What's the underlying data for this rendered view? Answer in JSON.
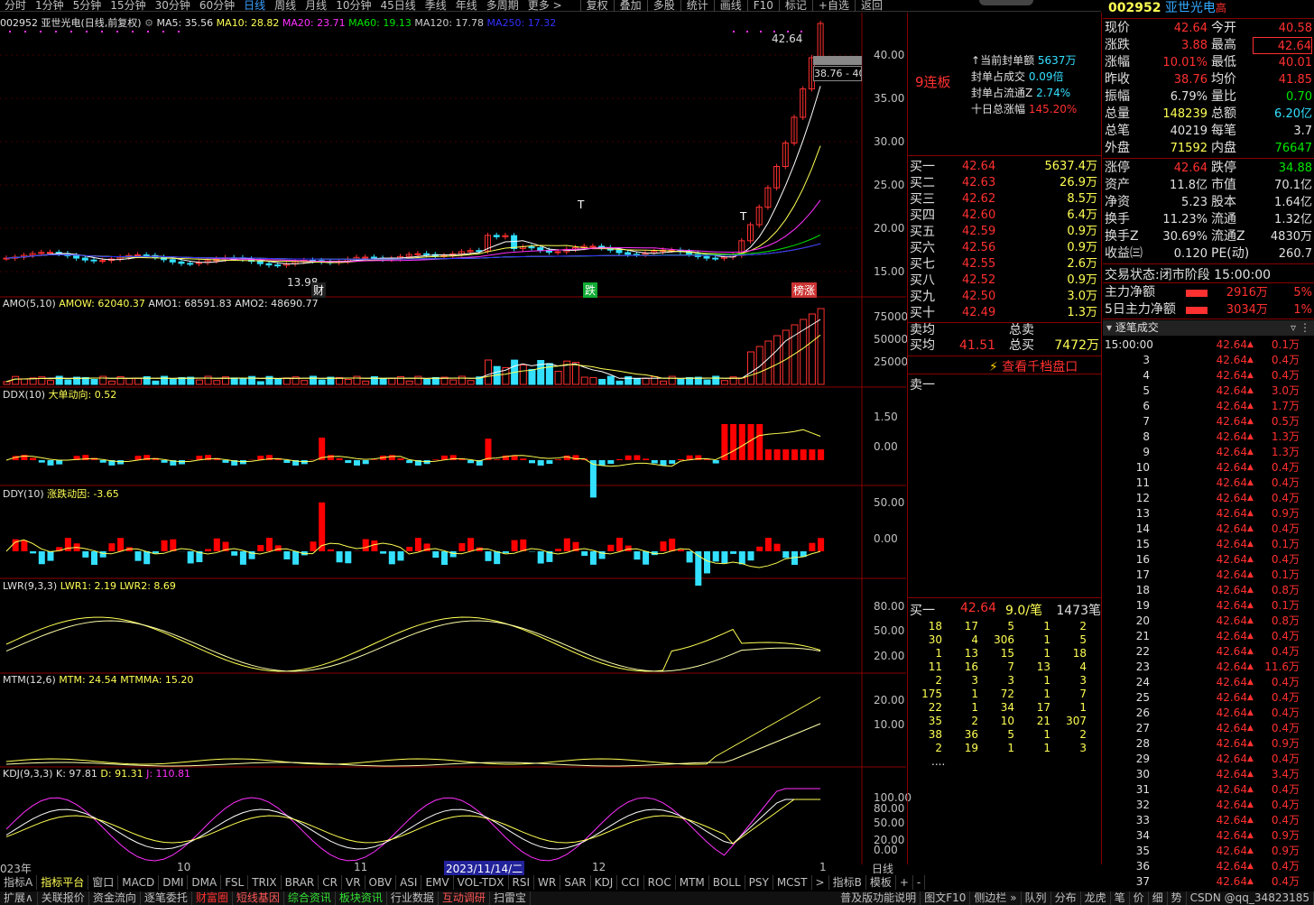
{
  "toolbar": {
    "periods": [
      "分时",
      "1分钟",
      "5分钟",
      "15分钟",
      "30分钟",
      "60分钟",
      "日线",
      "周线",
      "月线",
      "10分钟",
      "45日线",
      "季线",
      "年线",
      "多周期",
      "更多 >"
    ],
    "active": "日线",
    "right_buttons": [
      "复权",
      "叠加",
      "多股",
      "统计",
      "画线",
      "F10",
      "标记",
      "+自选",
      "返回"
    ]
  },
  "main_chart": {
    "title": "002952 亚世光电(日线,前复权)",
    "ma5": "MA5: 35.56",
    "ma10": "MA10: 28.82",
    "ma20": "MA20: 23.71",
    "ma60": "MA60: 19.13",
    "ma120": "MA120: 17.78",
    "ma250": "MA250: 17.32",
    "high_label": "42.64",
    "low_label": "13.98",
    "price_tag": "38.76 - 40",
    "marks": [
      "财",
      "跌",
      "榜涨"
    ],
    "t_mark": "T",
    "yaxis": [
      "40.00",
      "35.00",
      "30.00",
      "25.00",
      "20.00",
      "15.00"
    ],
    "lianban": "9连板"
  },
  "amo": {
    "title": "AMO(5,10)",
    "amow": "AMOW: 62040.37",
    "amo1": "AMO1: 68591.83",
    "amo2": "AMO2: 48690.77",
    "yaxis": [
      "75000",
      "50000",
      "25000"
    ]
  },
  "ddx": {
    "title": "DDX(10)",
    "label": "大单动向: 0.52",
    "yaxis": [
      "1.50",
      "0.00"
    ]
  },
  "ddy": {
    "title": "DDY(10)",
    "label": "涨跌动因: -3.65",
    "yaxis": [
      "50.00",
      "0.00"
    ]
  },
  "lwr": {
    "title": "LWR(9,3,3)",
    "lwr1": "LWR1: 2.19",
    "lwr2": "LWR2: 8.69",
    "yaxis": [
      "80.00",
      "50.00",
      "20.00"
    ]
  },
  "mtm": {
    "title": "MTM(12,6)",
    "mtm": "MTM: 24.54",
    "mtmma": "MTMMA: 15.20",
    "yaxis": [
      "20.00",
      "10.00"
    ]
  },
  "kdj": {
    "title": "KDJ(9,3,3)",
    "k": "K: 97.81",
    "d": "D: 91.31",
    "j": "J: 110.81",
    "yaxis": [
      "100.00",
      "80.00",
      "50.00",
      "20.00",
      "0.00"
    ]
  },
  "xaxis": {
    "labels": [
      "023年",
      "10",
      "11",
      "2023/11/14/二",
      "12",
      "1"
    ],
    "period": "日线"
  },
  "seal": {
    "amount_label": "当前封单额",
    "amount": "5637万",
    "ratio_label": "封单占成交",
    "ratio": "0.09倍",
    "float_label": "封单占流通Z",
    "float": "2.74%",
    "ten_day_label": "十日总涨幅",
    "ten_day": "145.20%"
  },
  "bids": [
    {
      "label": "买一",
      "price": "42.64",
      "vol": "5637.4万"
    },
    {
      "label": "买二",
      "price": "42.63",
      "vol": "26.9万"
    },
    {
      "label": "买三",
      "price": "42.62",
      "vol": "8.5万"
    },
    {
      "label": "买四",
      "price": "42.60",
      "vol": "6.4万"
    },
    {
      "label": "买五",
      "price": "42.59",
      "vol": "0.9万"
    },
    {
      "label": "买六",
      "price": "42.56",
      "vol": "0.9万"
    },
    {
      "label": "买七",
      "price": "42.55",
      "vol": "2.6万"
    },
    {
      "label": "买八",
      "price": "42.52",
      "vol": "0.9万"
    },
    {
      "label": "买九",
      "price": "42.50",
      "vol": "3.0万"
    },
    {
      "label": "买十",
      "price": "42.49",
      "vol": "1.3万"
    }
  ],
  "avg": {
    "sell_avg": "卖均",
    "buy_avg": "买均",
    "buy_avg_price": "41.51",
    "total_sell": "总卖",
    "total_buy": "总买",
    "total_buy_val": "7472万"
  },
  "depth_link": "查看千档盘口",
  "sell_one": "卖一",
  "queue": {
    "label": "买一",
    "price": "42.64",
    "per": "9.0/笔",
    "count": "1473笔",
    "rows": [
      [
        "18",
        "17",
        "5",
        "1",
        "2"
      ],
      [
        "30",
        "4",
        "306",
        "1",
        "5"
      ],
      [
        "1",
        "13",
        "15",
        "1",
        "18"
      ],
      [
        "11",
        "16",
        "7",
        "13",
        "4"
      ],
      [
        "2",
        "3",
        "3",
        "1",
        "3"
      ],
      [
        "175",
        "1",
        "72",
        "1",
        "7"
      ],
      [
        "22",
        "1",
        "34",
        "17",
        "1"
      ],
      [
        "35",
        "2",
        "10",
        "21",
        "307"
      ],
      [
        "38",
        "36",
        "5",
        "1",
        "2"
      ],
      [
        "2",
        "19",
        "1",
        "1",
        "3"
      ]
    ],
    "more": "...."
  },
  "stock": {
    "code": "002952",
    "name": "亚世光电",
    "tag": "高"
  },
  "quote": [
    [
      "现价",
      "42.64",
      "今开",
      "40.58"
    ],
    [
      "涨跌",
      "3.88",
      "最高",
      "42.64"
    ],
    [
      "涨幅",
      "10.01%",
      "最低",
      "40.01"
    ],
    [
      "昨收",
      "38.76",
      "均价",
      "41.85"
    ],
    [
      "振幅",
      "6.79%",
      "量比",
      "0.70"
    ],
    [
      "总量",
      "148239",
      "总额",
      "6.20亿"
    ],
    [
      "总笔",
      "40219",
      "每笔",
      "3.7"
    ],
    [
      "外盘",
      "71592",
      "内盘",
      "76647"
    ]
  ],
  "quote2": [
    [
      "涨停",
      "42.64",
      "跌停",
      "34.88"
    ],
    [
      "资产",
      "11.8亿",
      "市值",
      "70.1亿"
    ],
    [
      "净资",
      "5.23",
      "股本",
      "1.64亿"
    ],
    [
      "换手",
      "11.23%",
      "流通",
      "1.32亿"
    ],
    [
      "换手Z",
      "30.69%",
      "流通Z",
      "4830万"
    ],
    [
      "收益㈢",
      "0.120",
      "PE(动)",
      "260.7"
    ]
  ],
  "status": {
    "label": "交易状态:",
    "value": "闭市阶段 15:00:00"
  },
  "flow": [
    {
      "label": "主力净额",
      "value": "2916万",
      "pct": "5%"
    },
    {
      "label": "5日主力净额",
      "value": "3034万",
      "pct": "1%"
    }
  ],
  "ticks_title": "逐笔成交",
  "ticks_first_time": "15:00:00",
  "ticks": [
    [
      "",
      "42.64",
      "0.1万"
    ],
    [
      "3",
      "42.64",
      "0.4万"
    ],
    [
      "4",
      "42.64",
      "0.4万"
    ],
    [
      "5",
      "42.64",
      "3.0万"
    ],
    [
      "6",
      "42.64",
      "1.7万"
    ],
    [
      "7",
      "42.64",
      "0.5万"
    ],
    [
      "8",
      "42.64",
      "1.3万"
    ],
    [
      "9",
      "42.64",
      "1.3万"
    ],
    [
      "10",
      "42.64",
      "0.4万"
    ],
    [
      "11",
      "42.64",
      "0.4万"
    ],
    [
      "12",
      "42.64",
      "0.4万"
    ],
    [
      "13",
      "42.64",
      "0.9万"
    ],
    [
      "14",
      "42.64",
      "0.4万"
    ],
    [
      "15",
      "42.64",
      "0.1万"
    ],
    [
      "16",
      "42.64",
      "0.4万"
    ],
    [
      "17",
      "42.64",
      "0.1万"
    ],
    [
      "18",
      "42.64",
      "0.8万"
    ],
    [
      "19",
      "42.64",
      "0.1万"
    ],
    [
      "20",
      "42.64",
      "0.8万"
    ],
    [
      "21",
      "42.64",
      "0.4万"
    ],
    [
      "22",
      "42.64",
      "0.4万"
    ],
    [
      "23",
      "42.64",
      "11.6万"
    ],
    [
      "24",
      "42.64",
      "0.4万"
    ],
    [
      "25",
      "42.64",
      "0.4万"
    ],
    [
      "26",
      "42.64",
      "0.4万"
    ],
    [
      "27",
      "42.64",
      "0.4万"
    ],
    [
      "28",
      "42.64",
      "0.9万"
    ],
    [
      "29",
      "42.64",
      "0.4万"
    ],
    [
      "30",
      "42.64",
      "3.4万"
    ],
    [
      "31",
      "42.64",
      "0.4万"
    ],
    [
      "32",
      "42.64",
      "0.4万"
    ],
    [
      "33",
      "42.64",
      "0.4万"
    ],
    [
      "34",
      "42.64",
      "0.9万"
    ],
    [
      "35",
      "42.64",
      "0.9万"
    ],
    [
      "36",
      "42.64",
      "0.4万"
    ],
    [
      "37",
      "42.64",
      "0.4万"
    ]
  ],
  "indicator_tabs": [
    "指标A",
    "指标平台",
    "窗口",
    "MACD",
    "DMI",
    "DMA",
    "FSL",
    "TRIX",
    "BRAR",
    "CR",
    "VR",
    "OBV",
    "ASI",
    "EMV",
    "VOL-TDX",
    "RSI",
    "WR",
    "SAR",
    "KDJ",
    "CCI",
    "ROC",
    "MTM",
    "BOLL",
    "PSY",
    "MCST",
    ">",
    "指标B",
    "模板",
    "+",
    "-"
  ],
  "bottom_tabs": [
    "扩展∧",
    "关联报价",
    "资金流向",
    "逐笔委托",
    "财富圈",
    "短线基因",
    "综合资讯",
    "板块资讯",
    "行业数据",
    "互动调研",
    "扫雷宝"
  ],
  "bottom_right": [
    "普及版功能说明",
    "图文F10",
    "侧边栏 »",
    "队列",
    "分布",
    "龙虎",
    "笔",
    "价",
    "细",
    "势",
    "CSDN @qq_34823185"
  ],
  "colors": {
    "up": "#ff3030",
    "down": "#33e0ff",
    "ma5": "#ffffff",
    "ma10": "#ffff54",
    "ma20": "#ff30ff",
    "ma60": "#00e600",
    "ma120": "#c0c0c0",
    "ma250": "#3030ff"
  }
}
